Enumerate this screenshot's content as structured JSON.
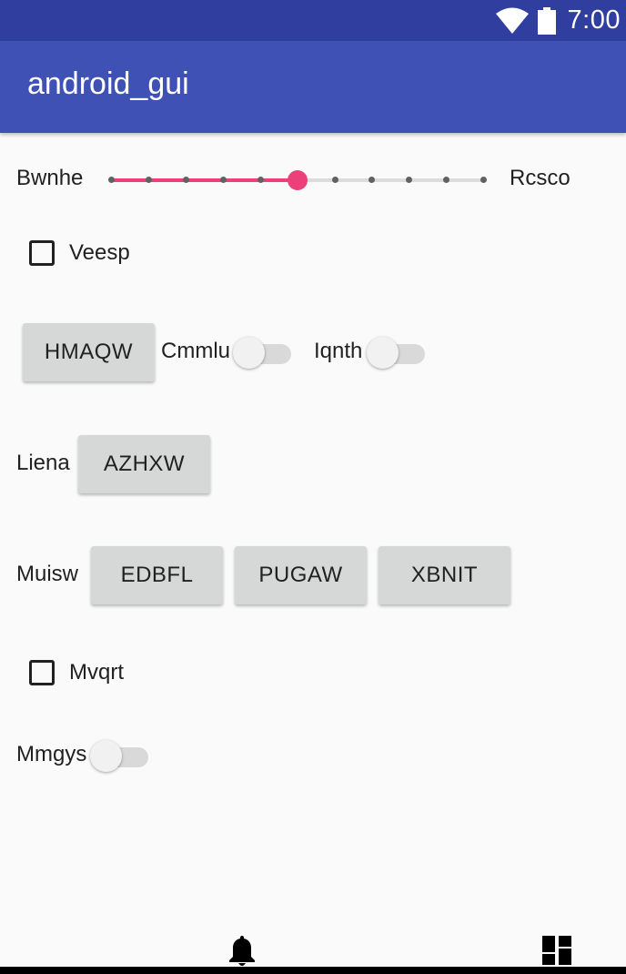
{
  "status_bar": {
    "time": "7:00",
    "icons": [
      "wifi-icon",
      "battery-icon"
    ]
  },
  "app_bar": {
    "title": "android_gui"
  },
  "seek_bar": {
    "left_label": "Bwnhe",
    "right_label": "Rcsco",
    "steps": 10,
    "value": 5,
    "accent_color": "#ec407a"
  },
  "checkbox_1": {
    "label": "Veesp",
    "checked": false
  },
  "row_1": {
    "button_label": "HMAQW",
    "switch_1_label": "Cmmlu",
    "switch_1_on": false,
    "switch_2_label": "Iqnth",
    "switch_2_on": false
  },
  "row_2": {
    "label": "Liena",
    "button_label": "AZHXW"
  },
  "row_3": {
    "label": "Muisw",
    "buttons": [
      "EDBFL",
      "PUGAW",
      "XBNIT"
    ]
  },
  "checkbox_2": {
    "label": "Mvqrt",
    "checked": false
  },
  "row_4": {
    "switch_label": "Mmgys",
    "switch_on": false
  },
  "bottom_icons": [
    "bell-icon",
    "dashboard-icon"
  ],
  "colors": {
    "status_bar": "#303f9f",
    "app_bar": "#3f51b5",
    "background": "#fafafa",
    "button": "#d6d7d7"
  }
}
